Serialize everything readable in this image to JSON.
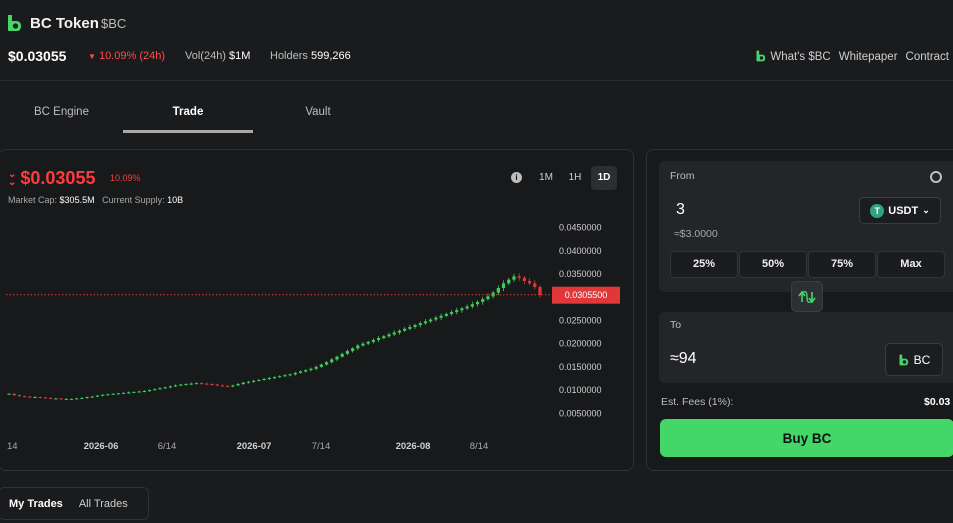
{
  "header": {
    "title": "BC Token",
    "ticker": "$BC",
    "price": "$0.03055",
    "change_24h": "10.09% (24h)",
    "volume_label": "Vol(24h)",
    "volume_value": "$1M",
    "holders_label": "Holders",
    "holders_value": "599,266",
    "links": [
      "What's $BC",
      "Whitepaper",
      "Contract"
    ],
    "logo_icon": "bc-logo-icon",
    "accent_color": "#45d66a",
    "down_color": "#ff3b3b"
  },
  "tabs": [
    "BC Engine",
    "Trade",
    "Vault"
  ],
  "active_tab": "Trade",
  "chart_panel": {
    "price": "$0.03055",
    "change": "10.09%",
    "market_cap_label": "Market Cap:",
    "market_cap_value": "$305.5M",
    "supply_label": "Current Supply:",
    "supply_value": "10B",
    "timeframes": [
      "1M",
      "1H",
      "1D"
    ],
    "active_timeframe": "1D",
    "current_price_tag": "0.0305500"
  },
  "chart_data": {
    "type": "candlestick",
    "y_ticks": [
      "0.0450000",
      "0.0400000",
      "0.0350000",
      "0.0300000",
      "0.0250000",
      "0.0200000",
      "0.0150000",
      "0.0100000",
      "0.0050000"
    ],
    "ylim": [
      0.0028,
      0.0488
    ],
    "x_ticks": [
      "14",
      "2026-06",
      "6/14",
      "2026-07",
      "7/14",
      "2026-08",
      "8/14"
    ],
    "x_tick_bold": [
      false,
      true,
      false,
      true,
      false,
      true,
      false
    ],
    "current_price": 0.03055,
    "up_color": "#3ecf5c",
    "down_color": "#e03838",
    "closes": [
      0.0092,
      0.0089,
      0.0087,
      0.0086,
      0.0085,
      0.0085,
      0.0084,
      0.0083,
      0.0082,
      0.0082,
      0.0081,
      0.0081,
      0.0081,
      0.0082,
      0.0083,
      0.0085,
      0.0086,
      0.0088,
      0.009,
      0.0091,
      0.0092,
      0.0093,
      0.0094,
      0.0095,
      0.0096,
      0.0097,
      0.0098,
      0.01,
      0.0102,
      0.0104,
      0.0106,
      0.0108,
      0.011,
      0.0112,
      0.0113,
      0.0114,
      0.0115,
      0.0114,
      0.0113,
      0.0112,
      0.011,
      0.0109,
      0.0108,
      0.011,
      0.0113,
      0.0116,
      0.0118,
      0.012,
      0.0122,
      0.0124,
      0.0126,
      0.0128,
      0.013,
      0.0132,
      0.0134,
      0.0137,
      0.014,
      0.0143,
      0.0146,
      0.015,
      0.0155,
      0.016,
      0.0166,
      0.0172,
      0.0178,
      0.0184,
      0.019,
      0.0196,
      0.02,
      0.0204,
      0.0208,
      0.0212,
      0.0216,
      0.022,
      0.0224,
      0.0228,
      0.0232,
      0.0236,
      0.024,
      0.0244,
      0.0248,
      0.0252,
      0.0256,
      0.026,
      0.0264,
      0.0268,
      0.0272,
      0.0276,
      0.028,
      0.0285,
      0.029,
      0.0296,
      0.0302,
      0.031,
      0.032,
      0.033,
      0.0338,
      0.0345,
      0.0342,
      0.0335,
      0.033,
      0.0322,
      0.0305
    ]
  },
  "trade_panel": {
    "from_label": "From",
    "from_value": "3",
    "from_usd": "≈$3.0000",
    "from_token": "USDT",
    "usdt_symbol": "T",
    "percent_buttons": [
      "25%",
      "50%",
      "75%",
      "Max"
    ],
    "to_label": "To",
    "to_value": "≈94",
    "to_token": "BC",
    "fees_label": "Est. Fees (1%):",
    "fees_value": "$0.03",
    "buy_label": "Buy BC"
  },
  "trades_tabs": [
    "My Trades",
    "All Trades"
  ],
  "active_trades_tab": "My Trades"
}
